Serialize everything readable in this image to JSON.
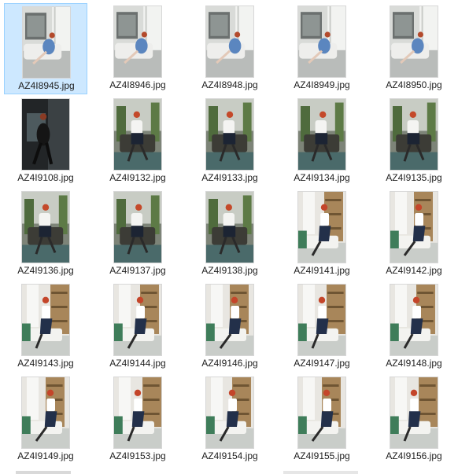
{
  "window": {
    "view": "large-icons",
    "selected_index": 0
  },
  "files": [
    {
      "name": "AZ4I8945.jpg",
      "scene": "sofa-window"
    },
    {
      "name": "AZ4I8946.jpg",
      "scene": "sofa-window"
    },
    {
      "name": "AZ4I8948.jpg",
      "scene": "sofa-window"
    },
    {
      "name": "AZ4I8949.jpg",
      "scene": "sofa-window"
    },
    {
      "name": "AZ4I8950.jpg",
      "scene": "sofa-window"
    },
    {
      "name": "AZ4I9108.jpg",
      "scene": "dark-chair"
    },
    {
      "name": "AZ4I9132.jpg",
      "scene": "chair-plants"
    },
    {
      "name": "AZ4I9133.jpg",
      "scene": "chair-plants"
    },
    {
      "name": "AZ4I9134.jpg",
      "scene": "chair-plants"
    },
    {
      "name": "AZ4I9135.jpg",
      "scene": "chair-plants"
    },
    {
      "name": "AZ4I9136.jpg",
      "scene": "chair-plants"
    },
    {
      "name": "AZ4I9137.jpg",
      "scene": "chair-plants"
    },
    {
      "name": "AZ4I9138.jpg",
      "scene": "chair-plants"
    },
    {
      "name": "AZ4I9141.jpg",
      "scene": "bookshelf-bench"
    },
    {
      "name": "AZ4I9142.jpg",
      "scene": "bookshelf-bench"
    },
    {
      "name": "AZ4I9143.jpg",
      "scene": "bookshelf-bench"
    },
    {
      "name": "AZ4I9144.jpg",
      "scene": "bookshelf-bench"
    },
    {
      "name": "AZ4I9146.jpg",
      "scene": "bookshelf-bench"
    },
    {
      "name": "AZ4I9147.jpg",
      "scene": "bookshelf-bench"
    },
    {
      "name": "AZ4I9148.jpg",
      "scene": "bookshelf-bench"
    },
    {
      "name": "AZ4I9149.jpg",
      "scene": "bookshelf-bench"
    },
    {
      "name": "AZ4I9153.jpg",
      "scene": "bookshelf-bench"
    },
    {
      "name": "AZ4I9154.jpg",
      "scene": "bookshelf-bench"
    },
    {
      "name": "AZ4I9155.jpg",
      "scene": "bookshelf-bench"
    },
    {
      "name": "AZ4I9156.jpg",
      "scene": "bookshelf-bench"
    }
  ],
  "colors": {
    "selection_fill": "#cde8ff",
    "selection_border": "#99d1ff",
    "label_text": "#1e1e1e"
  }
}
